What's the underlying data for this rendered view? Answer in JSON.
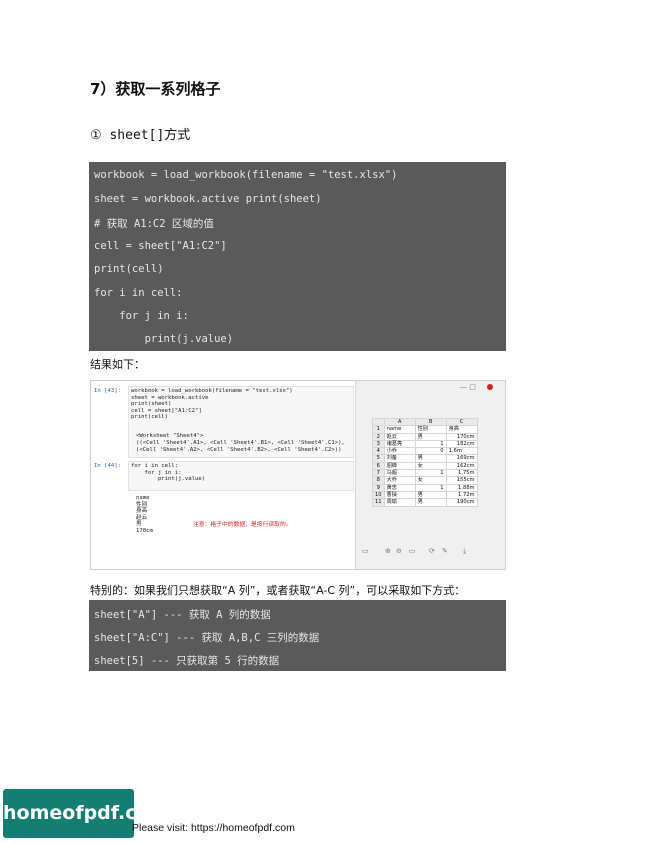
{
  "section_heading": "7）获取一系列格子",
  "sub_heading": "① sheet[]方式",
  "code_block_1": [
    "workbook = load_workbook(filename = \"test.xlsx\")",
    "sheet = workbook.active print(sheet)",
    "# 获取 A1:C2 区域的值",
    "cell = sheet[\"A1:C2\"]",
    "print(cell)",
    "for i in cell:",
    "    for j in i:",
    "        print(j.value)"
  ],
  "result_label": "结果如下：",
  "screenshot": {
    "cell1_prompt": "In [43]:",
    "cell1_code": [
      "workbook = load_workbook(filename = \"test.xlsx\")",
      "sheet = workbook.active",
      "print(sheet)",
      "cell = sheet[\"A1:C2\"]",
      "print(cell)"
    ],
    "cell1_output": [
      "<Worksheet \"Sheet4\">",
      "((<Cell 'Sheet4'.A1>, <Cell 'Sheet4'.B1>, <Cell 'Sheet4'.C1>),",
      "(<Cell 'Sheet4'.A2>, <Cell 'Sheet4'.B2>, <Cell 'Sheet4'.C2>))"
    ],
    "cell2_prompt": "In [44]:",
    "cell2_code": [
      "for i in cell:",
      "    for j in i:",
      "        print(j.value)"
    ],
    "cell2_output": [
      "name",
      "性别",
      "身高",
      "赵云",
      "男",
      "170cm"
    ],
    "note": "注意：格子中的数据，是按行读取的。",
    "viewer_title_controls": "—   □",
    "sheet_headers": [
      "A",
      "B",
      "C"
    ],
    "sheet_rows": [
      [
        "1",
        "name",
        "性别",
        "身高"
      ],
      [
        "2",
        "赵云",
        "男",
        "170cm"
      ],
      [
        "3",
        "诸葛亮",
        "1",
        "182cm"
      ],
      [
        "4",
        "小乔",
        "0",
        "1.6m"
      ],
      [
        "5",
        "刘备",
        "男",
        "169cm"
      ],
      [
        "6",
        "貂蝉",
        "女",
        "162cm"
      ],
      [
        "7",
        "马超",
        "1",
        "1.75m"
      ],
      [
        "8",
        "大乔",
        "女",
        "155cm"
      ],
      [
        "9",
        "黄忠",
        "1",
        "1.88m"
      ],
      [
        "10",
        "曹操",
        "男",
        "1.72m"
      ],
      [
        "11",
        "周瑜",
        "男",
        "190cm"
      ]
    ],
    "viewer_toolbar": [
      "▭",
      "⊕",
      "⊖",
      "▭",
      "⟳",
      "✎",
      "⤓"
    ]
  },
  "intro_text": "特别的：如果我们只想获取“A 列”，或者获取“A-C 列”，可以采取如下方式：",
  "code_block_2": [
    "sheet[\"A\"] --- 获取 A 列的数据",
    "sheet[\"A:C\"] --- 获取 A,B,C 三列的数据",
    "sheet[5] --- 只获取第 5 行的数据"
  ],
  "logo_text": "homeofpdf.com",
  "footer_text": "Please visit: https://homeofpdf.com"
}
